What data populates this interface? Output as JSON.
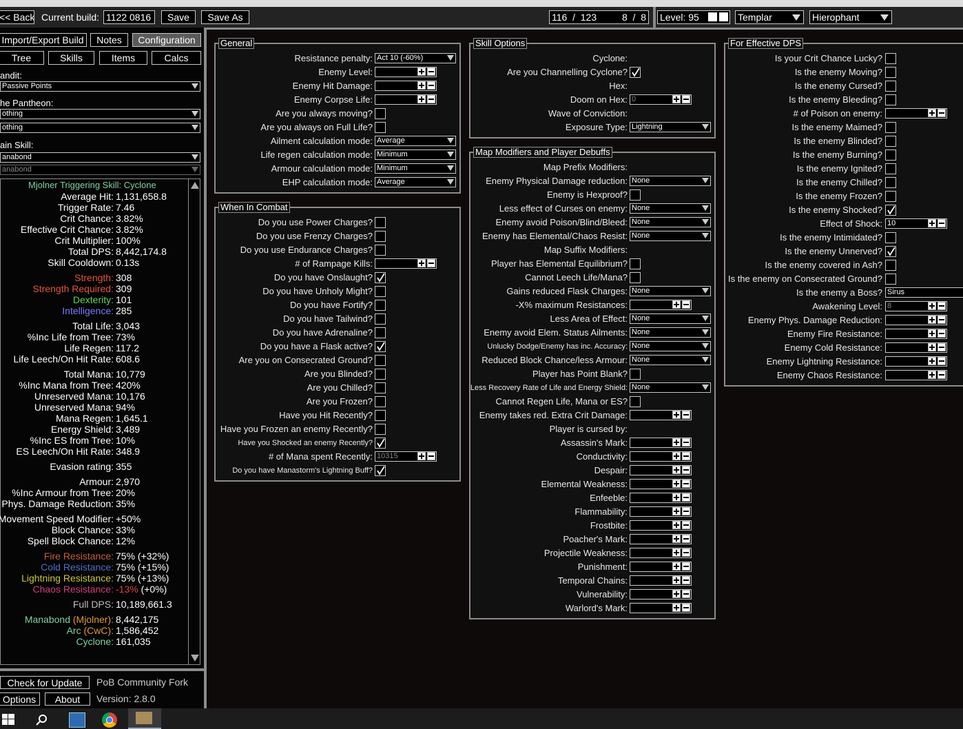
{
  "topbar": {
    "back": "<< Back",
    "current_build_label": "Current build:",
    "build_name": "1122 0816",
    "save": "Save",
    "save_as": "Save As",
    "points": "116  /  123",
    "ascend": "8  /  8",
    "level_label": "Level:",
    "level_value": "95",
    "class": "Templar",
    "ascendancy": "Hierophant"
  },
  "leftnav": {
    "import_export": "Import/Export Build",
    "notes": "Notes",
    "configuration": "Configuration",
    "tree": "Tree",
    "skills": "Skills",
    "items": "Items",
    "calcs": "Calcs",
    "bandit_label": "andit:",
    "bandit_value": "Passive Points",
    "pantheon_label": "he Pantheon:",
    "pantheon_major": "othing",
    "pantheon_minor": "othing",
    "main_skill_label": "ain Skill:",
    "main_skill": "anabond",
    "main_skill_sub": "anabond"
  },
  "stats": [
    {
      "l": "",
      "v": "Mjolner Triggering Skill: Cyclone",
      "lc": "#7fd1a0",
      "full": true
    },
    {
      "l": "Average Hit:",
      "v": "1,131,658.8"
    },
    {
      "l": "Trigger Rate:",
      "v": "7.46"
    },
    {
      "l": "Crit Chance:",
      "v": "3.82%"
    },
    {
      "l": "Effective Crit Chance:",
      "v": "3.82%"
    },
    {
      "l": "Crit Multiplier:",
      "v": "100%"
    },
    {
      "l": "Total DPS:",
      "v": "8,442,174.8"
    },
    {
      "l": "Skill Cooldown:",
      "v": "0.13s"
    },
    {
      "gap": true
    },
    {
      "l": "Strength:",
      "v": "308",
      "lc": "#e0533c"
    },
    {
      "l": "Strength Required:",
      "v": "309",
      "lc": "#e0533c"
    },
    {
      "l": "Dexterity:",
      "v": "101",
      "lc": "#5fd15f"
    },
    {
      "l": "Intelligence:",
      "v": "285",
      "lc": "#7878ff"
    },
    {
      "gap": true
    },
    {
      "l": "Total Life:",
      "v": "3,043"
    },
    {
      "l": "%Inc Life from Tree:",
      "v": "73%"
    },
    {
      "l": "Life Regen:",
      "v": "117.2"
    },
    {
      "l": "Life Leech/On Hit Rate:",
      "v": "608.6"
    },
    {
      "gap": true
    },
    {
      "l": "Total Mana:",
      "v": "10,779"
    },
    {
      "l": "%Inc Mana from Tree:",
      "v": "420%"
    },
    {
      "l": "Unreserved Mana:",
      "v": "10,176"
    },
    {
      "l": "Unreserved Mana:",
      "v": "94%"
    },
    {
      "l": "Mana Regen:",
      "v": "1,645.1"
    },
    {
      "l": "Energy Shield:",
      "v": "3,489"
    },
    {
      "l": "%Inc ES from Tree:",
      "v": "10%"
    },
    {
      "l": "ES Leech/On Hit Rate:",
      "v": "348.9"
    },
    {
      "gap": true
    },
    {
      "l": "Evasion rating:",
      "v": "355"
    },
    {
      "gap": true
    },
    {
      "l": "Armour:",
      "v": "2,970"
    },
    {
      "l": "%Inc Armour from Tree:",
      "v": "20%"
    },
    {
      "l": "Phys. Damage Reduction:",
      "v": "35%"
    },
    {
      "gap": true
    },
    {
      "l": "Movement Speed Modifier:",
      "v": "+50%"
    },
    {
      "l": "Block Chance:",
      "v": "33%"
    },
    {
      "l": "Spell Block Chance:",
      "v": "12%"
    },
    {
      "gap": true
    },
    {
      "l": "Fire Resistance:",
      "v": "75% (+32%)",
      "lc": "#c0603c"
    },
    {
      "l": "Cold Resistance:",
      "v": "75% (+15%)",
      "lc": "#4f6fc8"
    },
    {
      "l": "Lightning Resistance:",
      "v": "75% (+13%)",
      "lc": "#c8c83c"
    },
    {
      "l": "Chaos Resistance:",
      "v": "-13%",
      "v2": "(+0%)",
      "lc": "#d03c7c",
      "vc": "#e04040"
    },
    {
      "gap": true
    },
    {
      "l": "Full DPS:",
      "v": "10,189,661.3",
      "lc": "#bdbdbd"
    },
    {
      "gap": true
    },
    {
      "l": "Manabond",
      "l2": "(Mjolner):",
      "v": "8,442,175",
      "lc": "#7fd1a0",
      "lc2": "#e0963c"
    },
    {
      "l": "Arc",
      "l2": "(CwC):",
      "v": "1,586,452",
      "lc": "#7fd1a0",
      "lc2": "#e0963c"
    },
    {
      "l": "Cyclone:",
      "v": "161,035",
      "lc": "#7fd1a0"
    }
  ],
  "footer": {
    "check_update": "Check for Update",
    "fork": "PoB Community Fork",
    "options": "Options",
    "about": "About",
    "version": "Version: 2.8.0"
  },
  "general": {
    "title": "General",
    "rows": [
      {
        "label": "Resistance penalty:",
        "type": "dd",
        "value": "Act 10 (-60%)"
      },
      {
        "label": "Enemy Level:",
        "type": "num",
        "value": ""
      },
      {
        "label": "Enemy Hit Damage:",
        "type": "num",
        "value": ""
      },
      {
        "label": "Enemy Corpse Life:",
        "type": "num",
        "value": ""
      },
      {
        "label": "Are you always moving?",
        "type": "cb",
        "checked": false
      },
      {
        "label": "Are you always on Full Life?",
        "type": "cb",
        "checked": false
      },
      {
        "label": "Ailment calculation mode:",
        "type": "dd",
        "value": "Average"
      },
      {
        "label": "Life regen calculation mode:",
        "type": "dd",
        "value": "Minimum"
      },
      {
        "label": "Armour calculation mode:",
        "type": "dd",
        "value": "Minimum"
      },
      {
        "label": "EHP calculation mode:",
        "type": "dd",
        "value": "Average"
      }
    ]
  },
  "combat": {
    "title": "When In Combat",
    "rows": [
      {
        "label": "Do you use Power Charges?",
        "type": "cb",
        "checked": false
      },
      {
        "label": "Do you use Frenzy Charges?",
        "type": "cb",
        "checked": false
      },
      {
        "label": "Do you use Endurance Charges?",
        "type": "cb",
        "checked": false
      },
      {
        "label": "# of Rampage Kills:",
        "type": "num",
        "value": ""
      },
      {
        "label": "Do you have Onslaught?",
        "type": "cb",
        "checked": true
      },
      {
        "label": "Do you have Unholy Might?",
        "type": "cb",
        "checked": false
      },
      {
        "label": "Do you have Fortify?",
        "type": "cb",
        "checked": false
      },
      {
        "label": "Do you have Tailwind?",
        "type": "cb",
        "checked": false
      },
      {
        "label": "Do you have Adrenaline?",
        "type": "cb",
        "checked": false
      },
      {
        "label": "Do you have a Flask active?",
        "type": "cb",
        "checked": true
      },
      {
        "label": "Are you on Consecrated Ground?",
        "type": "cb",
        "checked": false
      },
      {
        "label": "Are you Blinded?",
        "type": "cb",
        "checked": false
      },
      {
        "label": "Are you Chilled?",
        "type": "cb",
        "checked": false
      },
      {
        "label": "Are you Frozen?",
        "type": "cb",
        "checked": false
      },
      {
        "label": "Have you Hit Recently?",
        "type": "cb",
        "checked": false
      },
      {
        "label": "Have you Frozen an enemy Recently?",
        "type": "cb",
        "checked": false
      },
      {
        "label": "Have you Shocked an enemy Recently?",
        "type": "cb",
        "checked": true,
        "small": true
      },
      {
        "label": "# of Mana spent Recently:",
        "type": "num",
        "value": "10315"
      },
      {
        "label": "Do you have Manastorm's Lightning Buff?",
        "type": "cb",
        "checked": true,
        "small": true
      }
    ]
  },
  "skillopts": {
    "title": "Skill Options",
    "rows": [
      {
        "label": "Cyclone:",
        "type": "none"
      },
      {
        "label": "Are you Channelling Cyclone?",
        "type": "cb",
        "checked": true
      },
      {
        "label": "Hex:",
        "type": "none"
      },
      {
        "label": "Doom on Hex:",
        "type": "num",
        "value": "0"
      },
      {
        "label": "Wave of Conviction:",
        "type": "none"
      },
      {
        "label": "Exposure Type:",
        "type": "dd",
        "value": "Lightning"
      }
    ]
  },
  "mapmods": {
    "title": "Map Modifiers and Player Debuffs",
    "rows": [
      {
        "label": "Map Prefix Modifiers:",
        "type": "none"
      },
      {
        "label": "Enemy Physical Damage reduction:",
        "type": "dd",
        "value": "None"
      },
      {
        "label": "Enemy is Hexproof?",
        "type": "cb",
        "checked": false
      },
      {
        "label": "Less effect of Curses on enemy:",
        "type": "dd",
        "value": "None"
      },
      {
        "label": "Enemy avoid Poison/Blind/Bleed:",
        "type": "dd",
        "value": "None"
      },
      {
        "label": "Enemy has Elemental/Chaos Resist:",
        "type": "dd",
        "value": "None"
      },
      {
        "label": "Map Suffix Modifiers:",
        "type": "none"
      },
      {
        "label": "Player has Elemental Equilibrium?",
        "type": "cb",
        "checked": false
      },
      {
        "label": "Cannot Leech Life/Mana?",
        "type": "cb",
        "checked": false
      },
      {
        "label": "Gains reduced Flask Charges:",
        "type": "dd",
        "value": "None"
      },
      {
        "label": "-X% maximum Resistances:",
        "type": "num",
        "value": ""
      },
      {
        "label": "Less Area of Effect:",
        "type": "dd",
        "value": "None"
      },
      {
        "label": "Enemy avoid Elem. Status Ailments:",
        "type": "dd",
        "value": "None"
      },
      {
        "label": "Unlucky Dodge/Enemy has inc. Accuracy:",
        "type": "dd",
        "value": "None",
        "small": true
      },
      {
        "label": "Reduced Block Chance/less Armour:",
        "type": "dd",
        "value": "None"
      },
      {
        "label": "Player has Point Blank?",
        "type": "cb",
        "checked": false
      },
      {
        "label": "Less Recovery Rate of Life and Energy Shield:",
        "type": "dd",
        "value": "None",
        "small": true
      },
      {
        "label": "Cannot Regen Life, Mana or ES?",
        "type": "cb",
        "checked": false
      },
      {
        "label": "Enemy takes red. Extra Crit Damage:",
        "type": "num",
        "value": ""
      },
      {
        "label": "Player is cursed by:",
        "type": "none"
      },
      {
        "label": "Assassin's Mark:",
        "type": "num",
        "value": ""
      },
      {
        "label": "Conductivity:",
        "type": "num",
        "value": ""
      },
      {
        "label": "Despair:",
        "type": "num",
        "value": ""
      },
      {
        "label": "Elemental Weakness:",
        "type": "num",
        "value": ""
      },
      {
        "label": "Enfeeble:",
        "type": "num",
        "value": ""
      },
      {
        "label": "Flammability:",
        "type": "num",
        "value": ""
      },
      {
        "label": "Frostbite:",
        "type": "num",
        "value": ""
      },
      {
        "label": "Poacher's Mark:",
        "type": "num",
        "value": ""
      },
      {
        "label": "Projectile Weakness:",
        "type": "num",
        "value": ""
      },
      {
        "label": "Punishment:",
        "type": "num",
        "value": ""
      },
      {
        "label": "Temporal Chains:",
        "type": "num",
        "value": ""
      },
      {
        "label": "Vulnerability:",
        "type": "num",
        "value": ""
      },
      {
        "label": "Warlord's Mark:",
        "type": "num",
        "value": ""
      }
    ]
  },
  "effdps": {
    "title": "For Effective DPS",
    "rows": [
      {
        "label": "Is your Crit Chance Lucky?",
        "type": "cb",
        "checked": false
      },
      {
        "label": "Is the enemy Moving?",
        "type": "cb",
        "checked": false
      },
      {
        "label": "Is the enemy Cursed?",
        "type": "cb",
        "checked": false
      },
      {
        "label": "Is the enemy Bleeding?",
        "type": "cb",
        "checked": false
      },
      {
        "label": "# of Poison on enemy:",
        "type": "num",
        "value": ""
      },
      {
        "label": "Is the enemy Maimed?",
        "type": "cb",
        "checked": false
      },
      {
        "label": "Is the enemy Blinded?",
        "type": "cb",
        "checked": false
      },
      {
        "label": "Is the enemy Burning?",
        "type": "cb",
        "checked": false
      },
      {
        "label": "Is the enemy Ignited?",
        "type": "cb",
        "checked": false
      },
      {
        "label": "Is the enemy Chilled?",
        "type": "cb",
        "checked": false
      },
      {
        "label": "Is the enemy Frozen?",
        "type": "cb",
        "checked": false
      },
      {
        "label": "Is the enemy Shocked?",
        "type": "cb",
        "checked": true
      },
      {
        "label": "Effect of Shock:",
        "type": "num",
        "value": "10",
        "bright": true
      },
      {
        "label": "Is the enemy Intimidated?",
        "type": "cb",
        "checked": false
      },
      {
        "label": "Is the enemy Unnerved?",
        "type": "cb",
        "checked": true
      },
      {
        "label": "Is the enemy covered in Ash?",
        "type": "cb",
        "checked": false
      },
      {
        "label": "Is the enemy on Consecrated Ground?",
        "type": "cb",
        "checked": false
      },
      {
        "label": "Is the enemy a Boss?",
        "type": "dd",
        "value": "Sirus",
        "wide": true
      },
      {
        "label": "Awakening Level:",
        "type": "num",
        "value": "8"
      },
      {
        "label": "Enemy Phys. Damage Reduction:",
        "type": "num",
        "value": ""
      },
      {
        "label": "Enemy Fire Resistance:",
        "type": "num",
        "value": ""
      },
      {
        "label": "Enemy Cold Resistance:",
        "type": "num",
        "value": ""
      },
      {
        "label": "Enemy Lightning Resistance:",
        "type": "num",
        "value": ""
      },
      {
        "label": "Enemy Chaos Resistance:",
        "type": "num",
        "value": ""
      }
    ]
  },
  "taskbar": {
    "start_icon": "windows-icon",
    "search_icon": "search-icon"
  }
}
